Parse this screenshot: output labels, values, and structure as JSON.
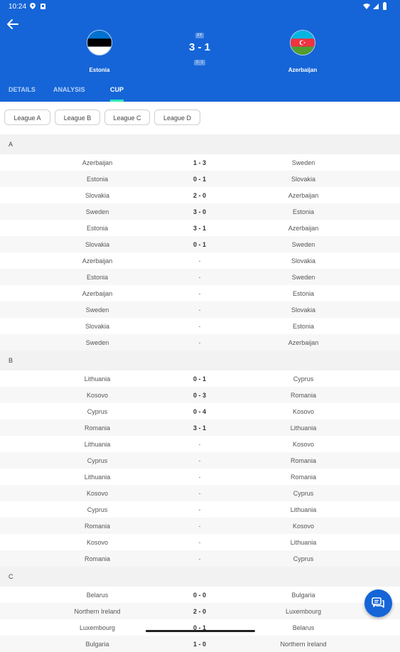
{
  "status": {
    "time": "10:24"
  },
  "match": {
    "home": {
      "name": "Estonia"
    },
    "away": {
      "name": "Azerbaijan"
    },
    "status_label": "FT",
    "score": "3 - 1",
    "halftime": "2 - 1"
  },
  "tabs": [
    {
      "label": "DETAILS"
    },
    {
      "label": "ANALYSIS"
    },
    {
      "label": "CUP"
    }
  ],
  "chips": [
    {
      "label": "League A"
    },
    {
      "label": "League B"
    },
    {
      "label": "League C"
    },
    {
      "label": "League D"
    }
  ],
  "groups": [
    {
      "label": "A",
      "matches": [
        {
          "home": "Azerbaijan",
          "result": "1 - 3",
          "away": "Sweden"
        },
        {
          "home": "Estonia",
          "result": "0 - 1",
          "away": "Slovakia"
        },
        {
          "home": "Slovakia",
          "result": "2 - 0",
          "away": "Azerbaijan"
        },
        {
          "home": "Sweden",
          "result": "3 - 0",
          "away": "Estonia"
        },
        {
          "home": "Estonia",
          "result": "3 - 1",
          "away": "Azerbaijan"
        },
        {
          "home": "Slovakia",
          "result": "0 - 1",
          "away": "Sweden"
        },
        {
          "home": "Azerbaijan",
          "result": "-",
          "away": "Slovakia"
        },
        {
          "home": "Estonia",
          "result": "-",
          "away": "Sweden"
        },
        {
          "home": "Azerbaijan",
          "result": "-",
          "away": "Estonia"
        },
        {
          "home": "Sweden",
          "result": "-",
          "away": "Slovakia"
        },
        {
          "home": "Slovakia",
          "result": "-",
          "away": "Estonia"
        },
        {
          "home": "Sweden",
          "result": "-",
          "away": "Azerbaijan"
        }
      ]
    },
    {
      "label": "B",
      "matches": [
        {
          "home": "Lithuania",
          "result": "0 - 1",
          "away": "Cyprus"
        },
        {
          "home": "Kosovo",
          "result": "0 - 3",
          "away": "Romania"
        },
        {
          "home": "Cyprus",
          "result": "0 - 4",
          "away": "Kosovo"
        },
        {
          "home": "Romania",
          "result": "3 - 1",
          "away": "Lithuania"
        },
        {
          "home": "Lithuania",
          "result": "-",
          "away": "Kosovo"
        },
        {
          "home": "Cyprus",
          "result": "-",
          "away": "Romania"
        },
        {
          "home": "Lithuania",
          "result": "-",
          "away": "Romania"
        },
        {
          "home": "Kosovo",
          "result": "-",
          "away": "Cyprus"
        },
        {
          "home": "Cyprus",
          "result": "-",
          "away": "Lithuania"
        },
        {
          "home": "Romania",
          "result": "-",
          "away": "Kosovo"
        },
        {
          "home": "Kosovo",
          "result": "-",
          "away": "Lithuania"
        },
        {
          "home": "Romania",
          "result": "-",
          "away": "Cyprus"
        }
      ]
    },
    {
      "label": "C",
      "matches": [
        {
          "home": "Belarus",
          "result": "0 - 0",
          "away": "Bulgaria"
        },
        {
          "home": "Northern Ireland",
          "result": "2 - 0",
          "away": "Luxembourg"
        },
        {
          "home": "Luxembourg",
          "result": "0 - 1",
          "away": "Belarus"
        },
        {
          "home": "Bulgaria",
          "result": "1 - 0",
          "away": "Northern Ireland"
        }
      ]
    }
  ],
  "colors": {
    "header": "#1565d8",
    "tab_indicator": "#2ee8b7",
    "group_bg": "#f2f2f2"
  },
  "icons": {
    "back": "arrow-left-icon",
    "fab": "chat-icon"
  }
}
